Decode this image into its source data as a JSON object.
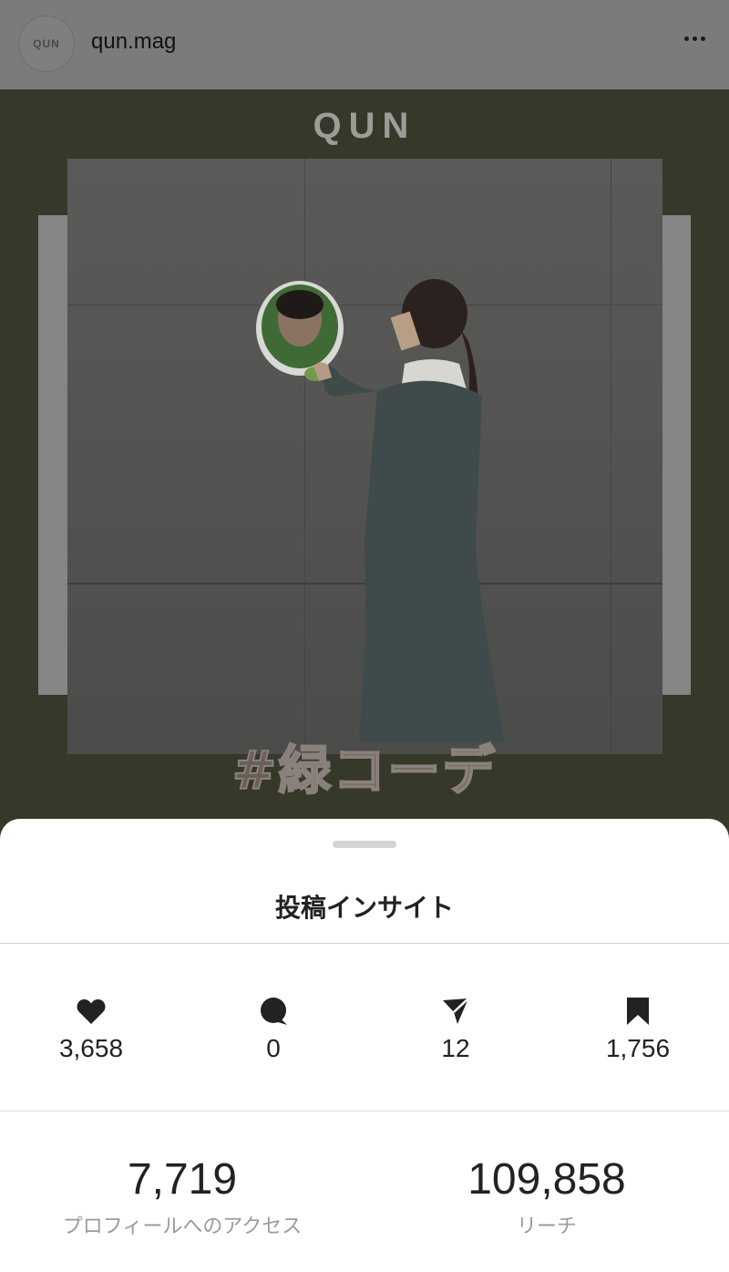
{
  "header": {
    "avatar_text": "QUN",
    "username": "qun.mag",
    "more_icon": "more-horizontal-icon"
  },
  "post": {
    "brand": "QUN",
    "hashtag": "#緑コーデ",
    "background_color": "#36382a"
  },
  "sheet": {
    "title": "投稿インサイト",
    "stats": [
      {
        "icon": "heart-icon",
        "value": "3,658"
      },
      {
        "icon": "comment-icon",
        "value": "0"
      },
      {
        "icon": "send-icon",
        "value": "12"
      },
      {
        "icon": "bookmark-icon",
        "value": "1,756"
      }
    ],
    "summary": [
      {
        "value": "7,719",
        "label": "プロフィールへのアクセス"
      },
      {
        "value": "109,858",
        "label": "リーチ"
      }
    ]
  }
}
